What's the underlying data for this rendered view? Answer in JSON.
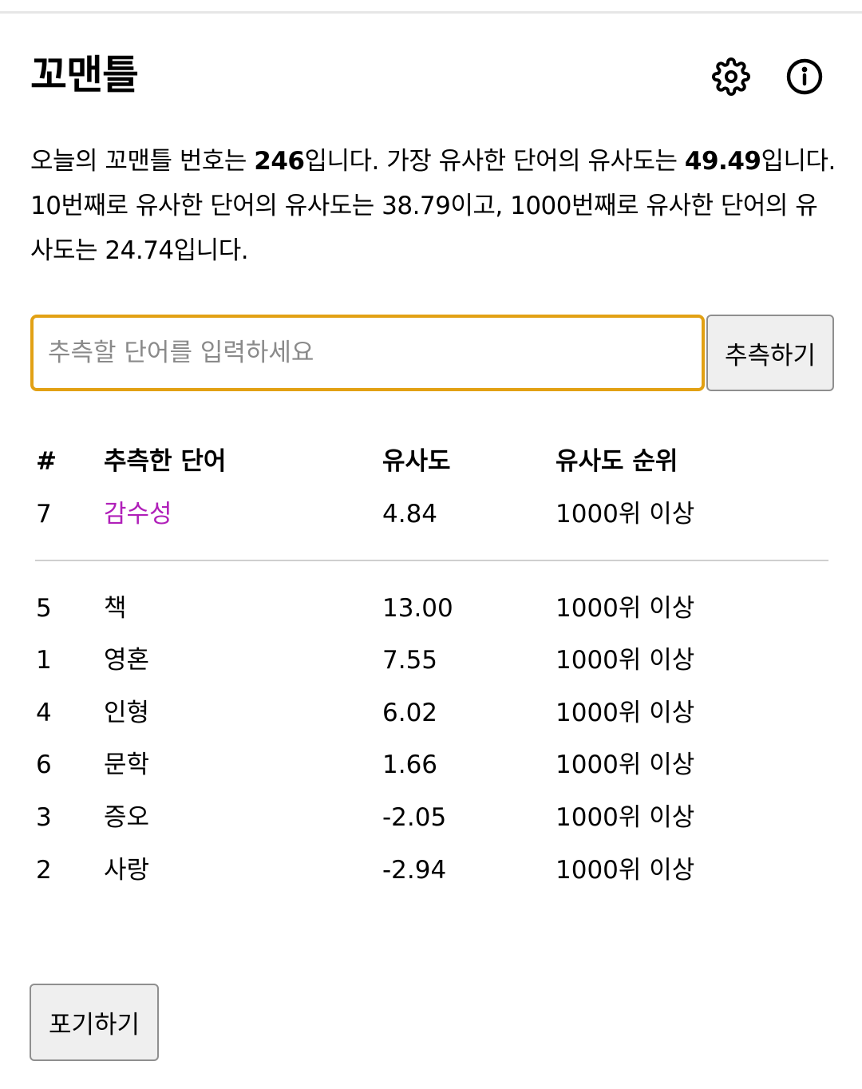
{
  "header": {
    "title": "꼬맨틀",
    "settings_icon": "gear-icon",
    "info_icon": "info-icon"
  },
  "intro": {
    "p1": "오늘의 꼬맨틀 번호는 ",
    "puzzle_number": "246",
    "p2": "입니다. 가장 유사한 단어의 유사도는 ",
    "top_similarity": "49.49",
    "p3": "입니다. 10번째로 유사한 단어의 유사도는 38.79이고, 1000번째로 유사한 단어의 유사도는 24.74입니다."
  },
  "guess": {
    "placeholder": "추측할 단어를 입력하세요",
    "value": "",
    "button_label": "추측하기"
  },
  "table": {
    "headers": [
      "#",
      "추측한 단어",
      "유사도",
      "유사도 순위"
    ],
    "latest": {
      "num": "7",
      "word": "감수성",
      "similarity": "4.84",
      "rank": "1000위 이상"
    },
    "rows": [
      {
        "num": "5",
        "word": "책",
        "similarity": "13.00",
        "rank": "1000위 이상"
      },
      {
        "num": "1",
        "word": "영혼",
        "similarity": "7.55",
        "rank": "1000위 이상"
      },
      {
        "num": "4",
        "word": "인형",
        "similarity": "6.02",
        "rank": "1000위 이상"
      },
      {
        "num": "6",
        "word": "문학",
        "similarity": "1.66",
        "rank": "1000위 이상"
      },
      {
        "num": "3",
        "word": "증오",
        "similarity": "-2.05",
        "rank": "1000위 이상"
      },
      {
        "num": "2",
        "word": "사랑",
        "similarity": "-2.94",
        "rank": "1000위 이상"
      }
    ]
  },
  "give_up_label": "포기하기",
  "colors": {
    "input_border": "#e2a114",
    "latest_word": "#b01fb9",
    "button_bg": "#efefef"
  }
}
